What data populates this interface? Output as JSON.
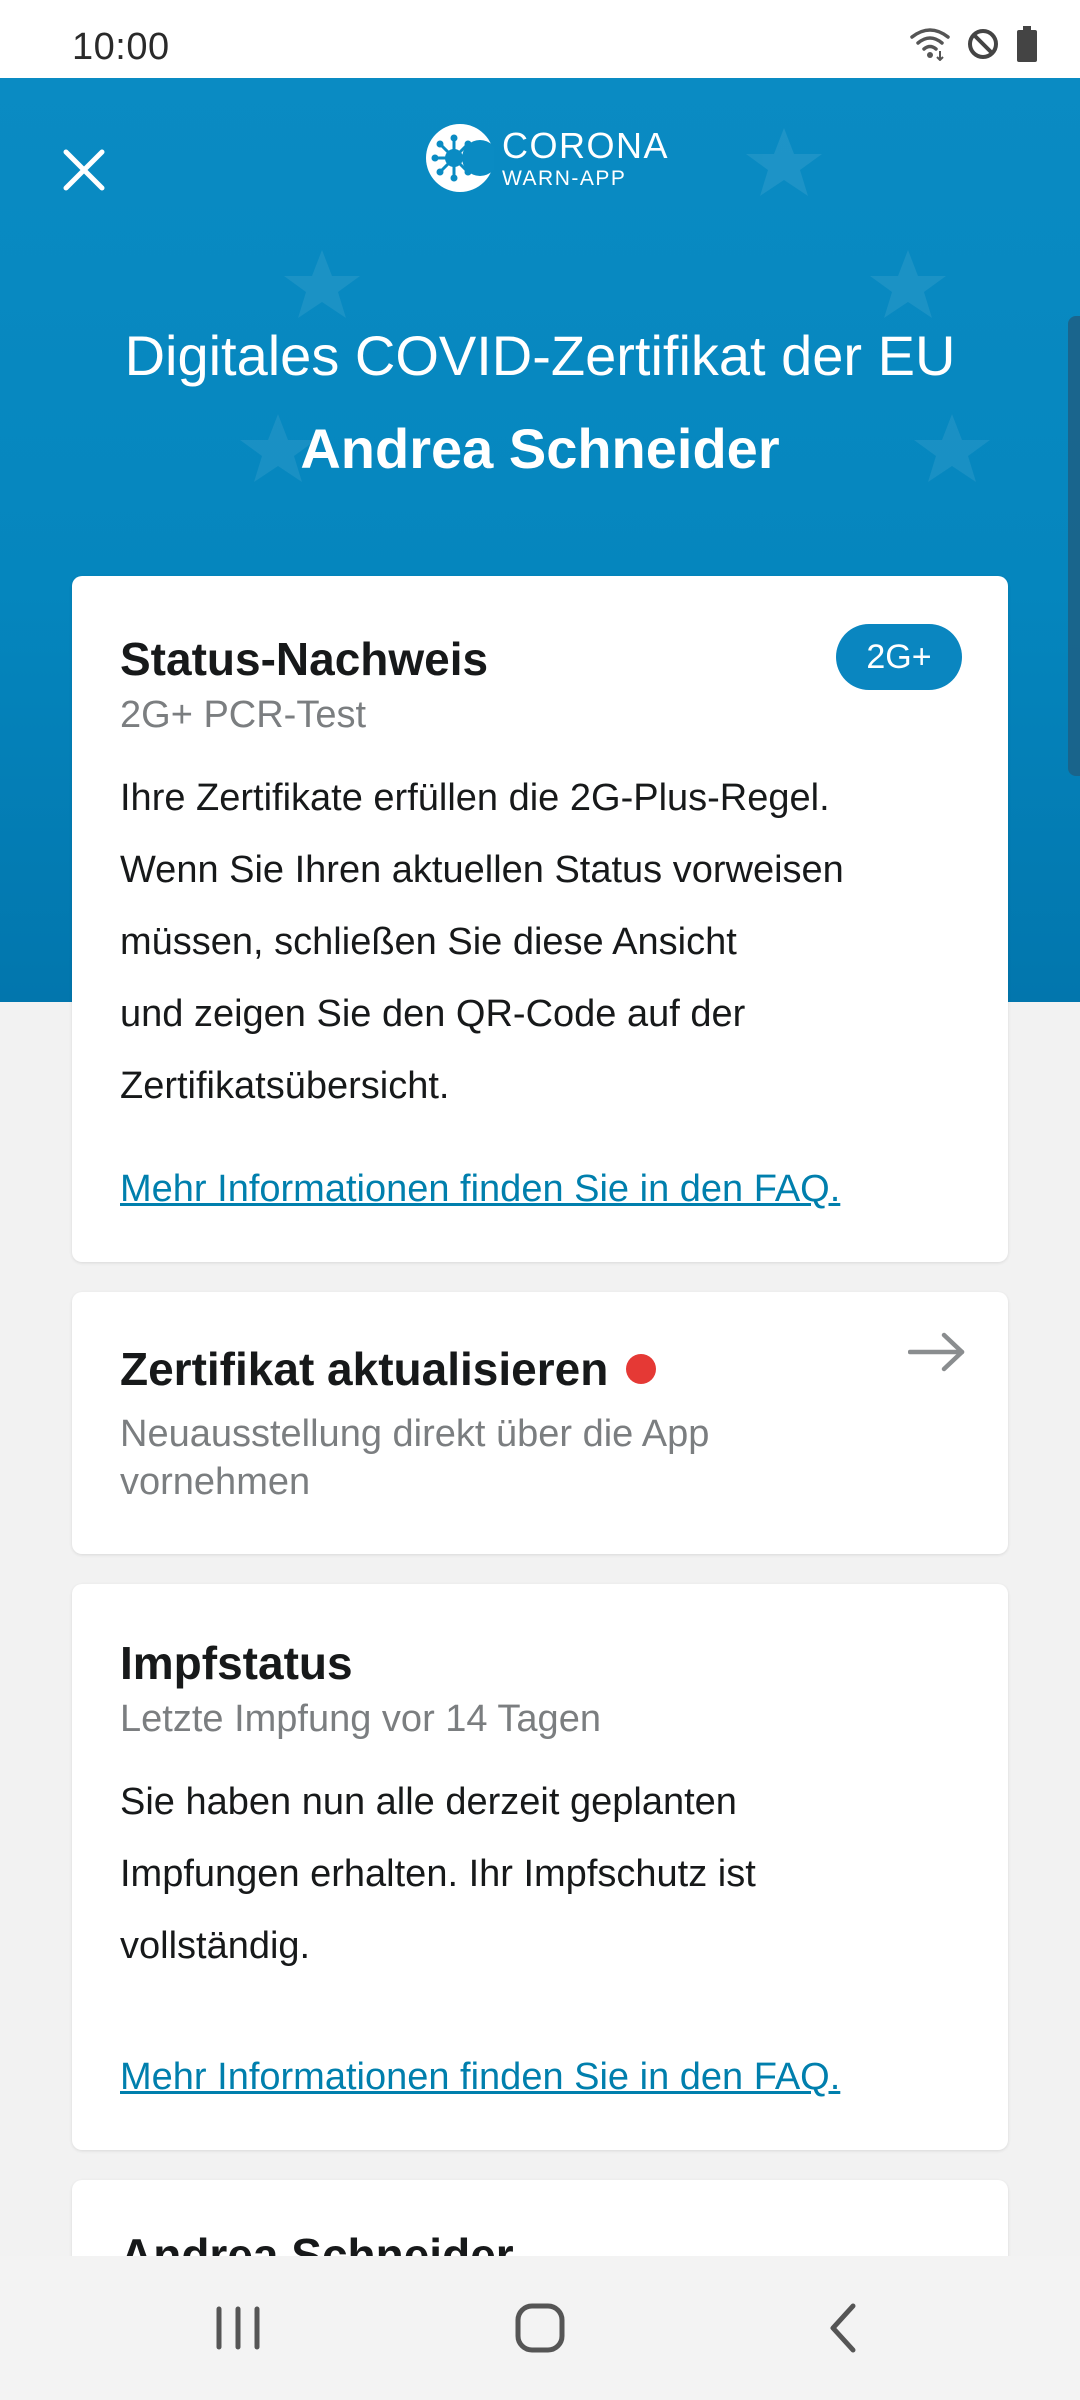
{
  "status_bar": {
    "time": "10:00"
  },
  "header": {
    "logo_line1": "CORONA",
    "logo_line2": "WARN-APP",
    "title": "Digitales COVID-Zertifikat der EU",
    "name": "Andrea Schneider",
    "background_color": "#0586be"
  },
  "status_card": {
    "title": "Status-Nachweis",
    "badge": "2G+",
    "subtitle": "2G+ PCR-Test",
    "body_lines": [
      "Ihre Zertifikate erfüllen die 2G-Plus-Regel.",
      "Wenn Sie Ihren aktuellen Status vorweisen",
      "müssen, schließen Sie diese Ansicht",
      "und zeigen Sie den QR-Code auf der",
      "Zertifikatsübersicht."
    ],
    "link": "Mehr Informationen finden Sie in den FAQ."
  },
  "update_card": {
    "title": "Zertifikat aktualisieren",
    "subtitle_lines": [
      "Neuausstellung direkt über die App",
      "vornehmen"
    ],
    "indicator_color": "#e53935"
  },
  "vaccination_card": {
    "title": "Impfstatus",
    "subtitle": "Letzte Impfung vor 14 Tagen",
    "body_lines": [
      "Sie haben nun alle derzeit geplanten",
      "Impfungen erhalten. Ihr Impfschutz ist",
      "vollständig."
    ],
    "link": "Mehr Informationen finden Sie in den FAQ."
  },
  "person_card": {
    "title": "Andrea Schneider"
  },
  "colors": {
    "accent": "#0a86c0",
    "link": "#007fad",
    "page_background": "#f2f2f2"
  },
  "icons": {
    "close": "close-icon",
    "arrow": "arrow-right-icon",
    "wifi": "wifi-icon",
    "dnd": "do-not-disturb-icon",
    "battery": "battery-icon"
  }
}
